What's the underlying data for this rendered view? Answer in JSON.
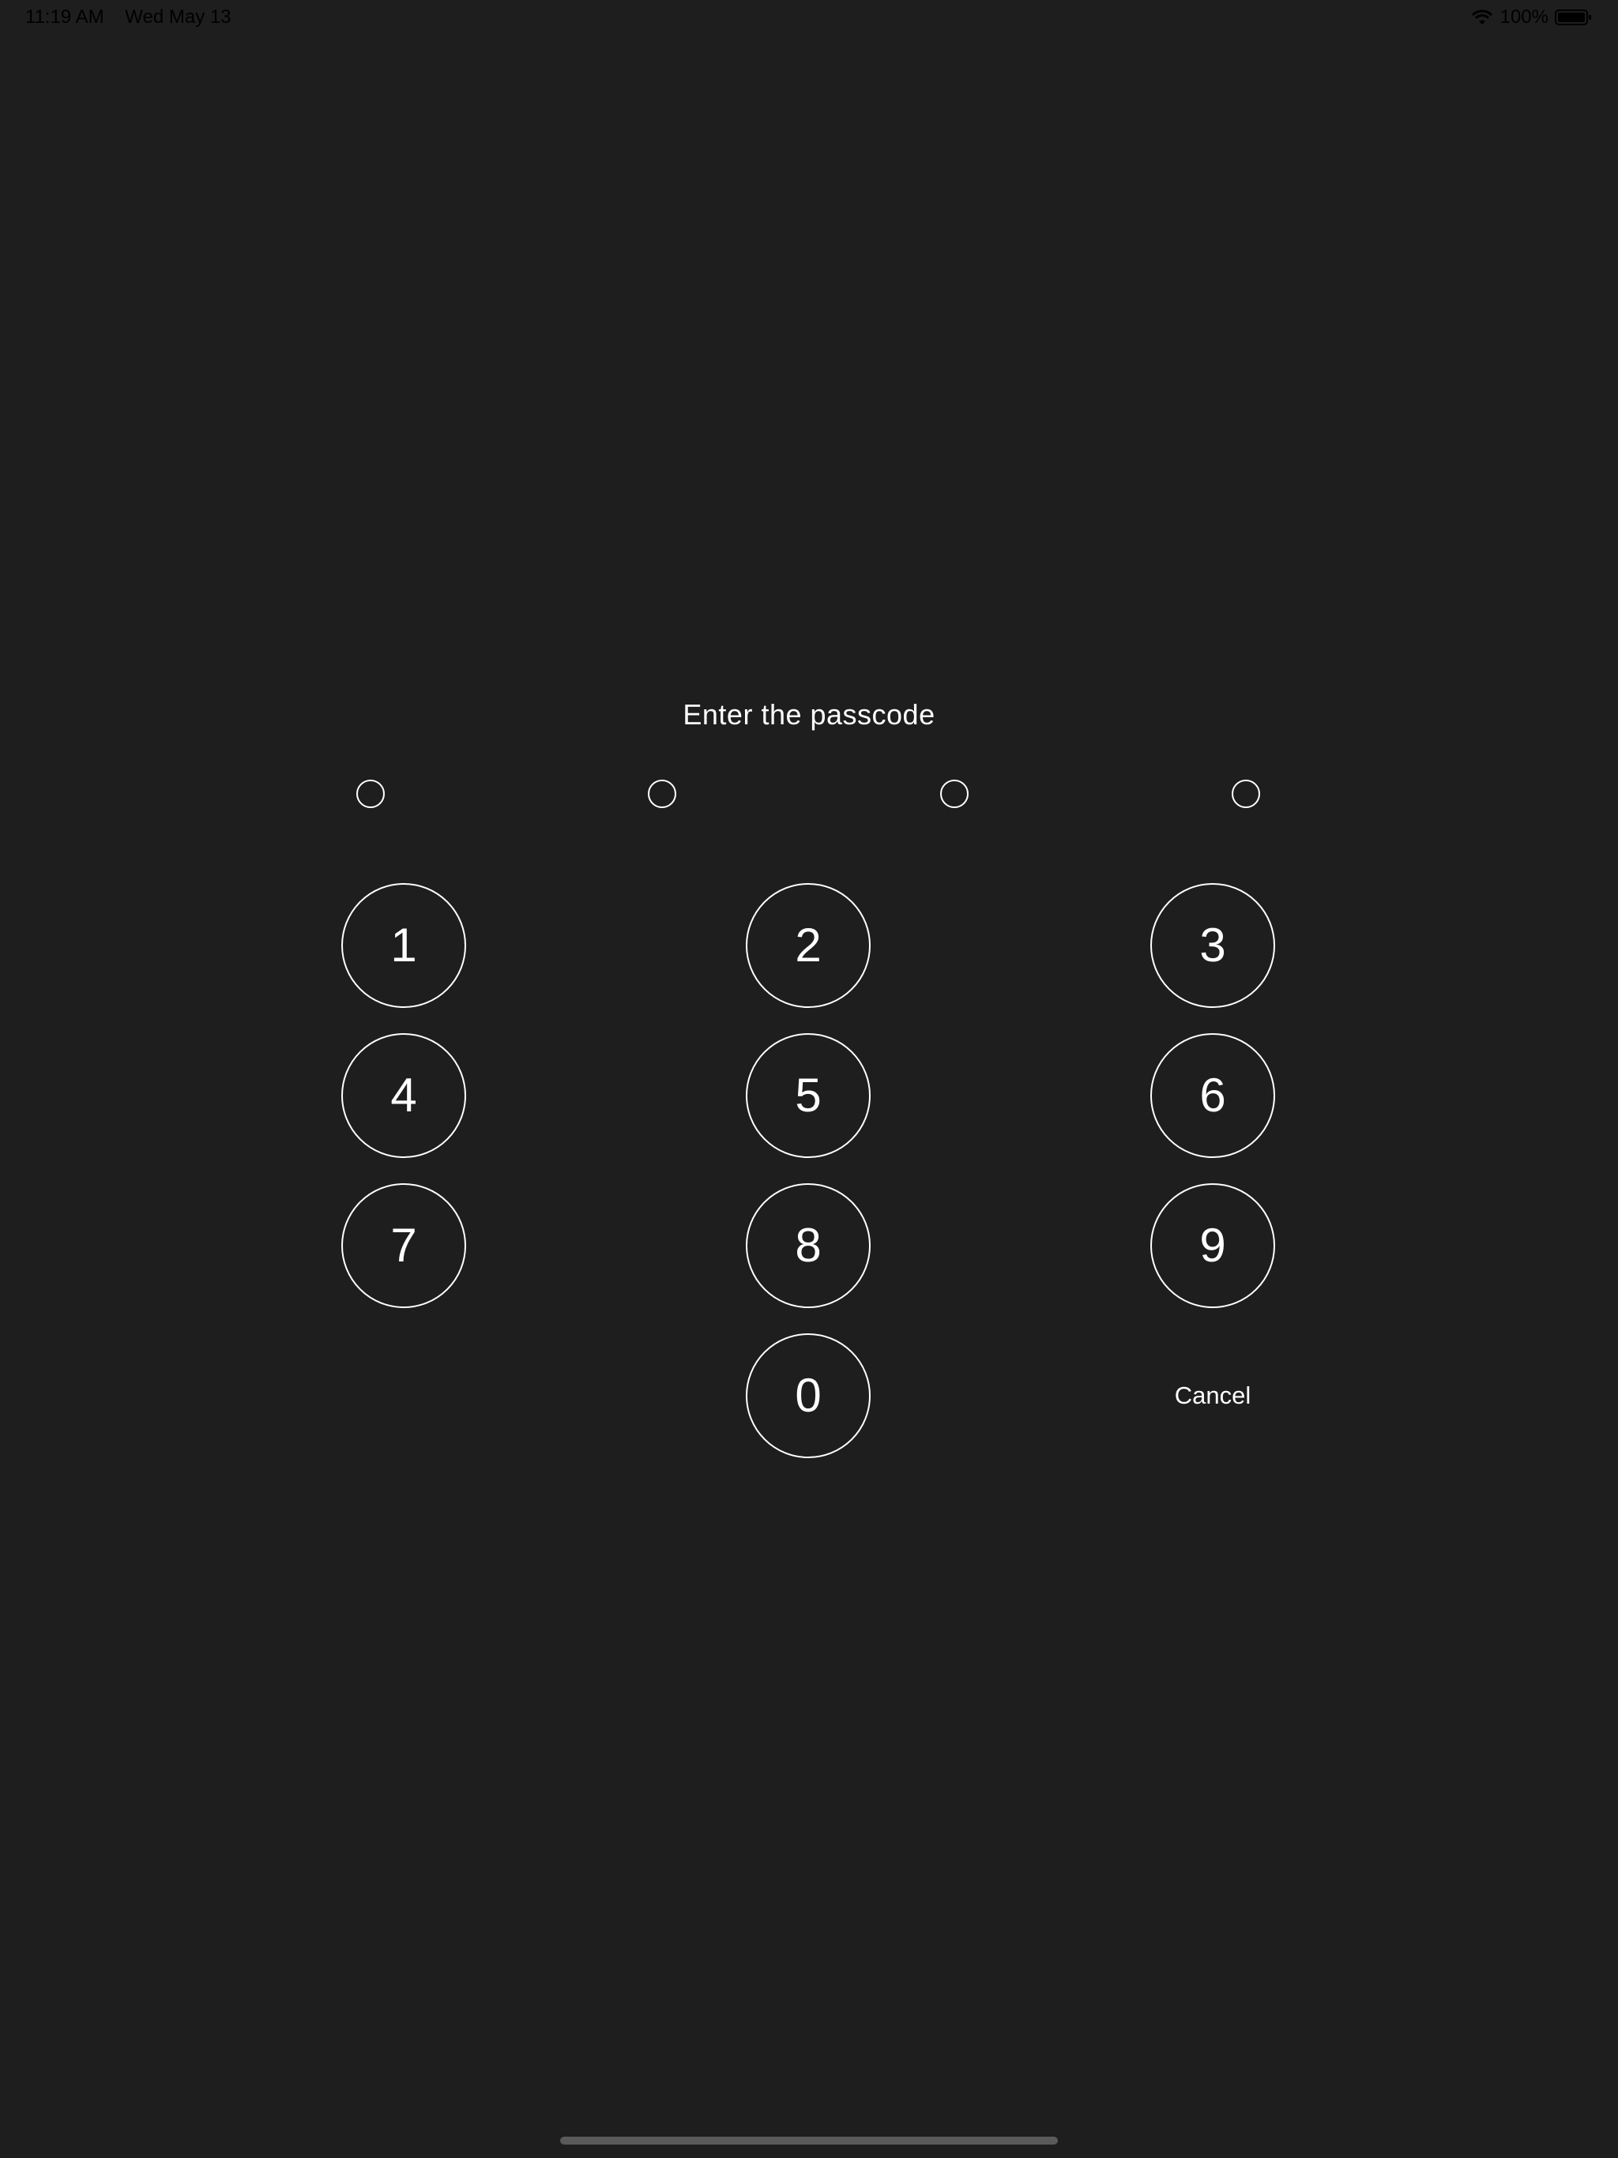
{
  "status_bar": {
    "time": "11:19 AM",
    "date": "Wed May 13",
    "battery": "100%"
  },
  "passcode": {
    "title": "Enter the passcode",
    "dots_filled": 0,
    "dots_total": 4
  },
  "keypad": {
    "keys": [
      "1",
      "2",
      "3",
      "4",
      "5",
      "6",
      "7",
      "8",
      "9",
      "0"
    ],
    "cancel_label": "Cancel"
  },
  "colors": {
    "background": "#1e1e1e",
    "foreground": "#ffffff",
    "status_text": "#000000",
    "home_indicator": "#5a5a5a"
  },
  "icons": {
    "wifi": "wifi-icon",
    "battery": "battery-icon"
  }
}
